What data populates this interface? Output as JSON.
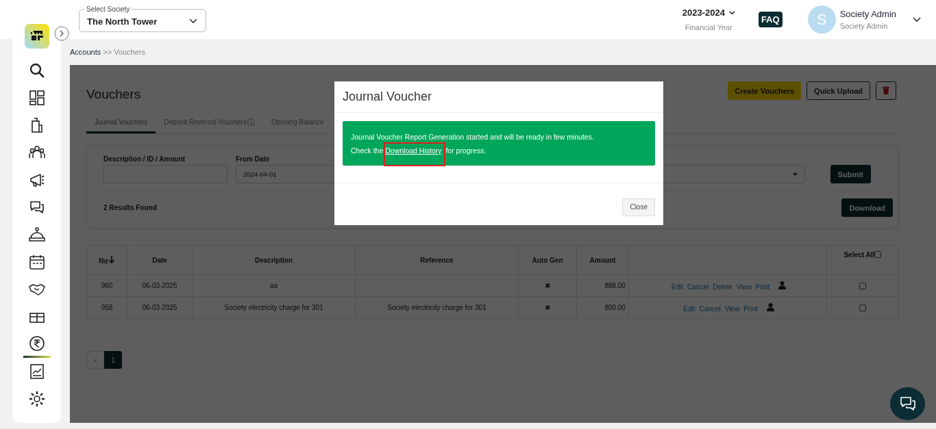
{
  "top_bar": {
    "society_select": {
      "label": "Select Society",
      "value": "The North Tower"
    },
    "financial_year": {
      "value": "2023-2024",
      "label": "Financial Year"
    },
    "faq": "FAQ",
    "user": {
      "initial": "S",
      "name": "Society Admin",
      "role": "Society Admin"
    }
  },
  "sidebar": {
    "items": [
      {
        "selected": false
      },
      {
        "selected": false
      },
      {
        "selected": false
      },
      {
        "selected": false
      },
      {
        "selected": false
      },
      {
        "selected": false
      },
      {
        "selected": false
      },
      {
        "selected": false
      },
      {
        "selected": false
      },
      {
        "selected": false
      },
      {
        "selected": true
      },
      {
        "selected": false
      },
      {
        "selected": false
      }
    ]
  },
  "breadcrumb": {
    "parent": "Accounts",
    "separator": ">>",
    "current": "Vouchers"
  },
  "page": {
    "title": "Vouchers",
    "actions": [
      "Create Vouchers",
      "Quick Upload"
    ],
    "tabs": [
      {
        "label": "Journal Vouchers",
        "selected": true,
        "info": false
      },
      {
        "label": "Deposit Reversal Vouchers",
        "selected": false,
        "info": true
      },
      {
        "label": "Opening Balance",
        "selected": false,
        "info": false
      }
    ],
    "filters": [
      {
        "kind": "text",
        "label": "Description / ID / Amount"
      },
      {
        "kind": "text",
        "label": "From Date",
        "value": "2024-04-01"
      },
      {
        "kind": "select"
      }
    ],
    "submit": "Submit",
    "results": "2 Results Found",
    "download": "Download"
  },
  "table": {
    "columns": [
      {
        "label": "No",
        "sort": true
      },
      {
        "label": "Date"
      },
      {
        "label": "Description"
      },
      {
        "label": "Reference"
      },
      {
        "label": "Auto Gen"
      },
      {
        "label": "Amount"
      },
      {
        "label": "Select All",
        "checked": false
      }
    ],
    "rows": [
      {
        "no": "960",
        "date": "06-03-2025",
        "description": "aa",
        "auto_gen": "✖",
        "amount": "888.00",
        "actions": [
          "Edit",
          "Cancel",
          "Delete",
          "View",
          "Print"
        ],
        "checked": false
      },
      {
        "no": "958",
        "date": "06-03-2025",
        "description": "Society electricity charge for 301",
        "reference": "Society electricity charge for 301",
        "auto_gen": "✖",
        "amount": "800.00",
        "actions": [
          "Edit",
          "Cancel",
          "View",
          "Print"
        ],
        "checked": false
      }
    ]
  },
  "pagination": {
    "prev": "«",
    "pages": [
      {
        "label": "1",
        "selected": true
      }
    ]
  },
  "modal": {
    "title": "Journal Voucher",
    "message": "Journal Voucher Report Generation started and will be ready in few minutes.",
    "check_prefix": "Check the",
    "link": {
      "text": "Download History",
      "highlighted": true
    },
    "check_suffix": "for progress.",
    "close": "Close"
  }
}
